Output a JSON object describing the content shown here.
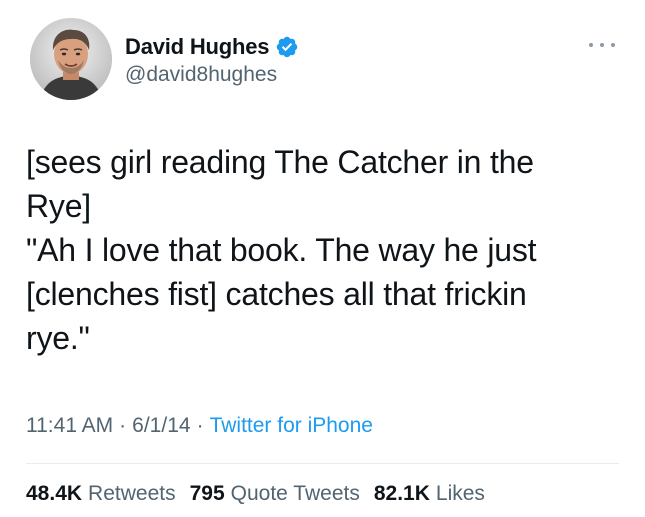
{
  "author": {
    "name": "David Hughes",
    "handle": "@david8hughes",
    "verified": true,
    "verified_color": "#1d9bf0"
  },
  "tweet": {
    "text": "[sees girl reading The Catcher in the\nRye]\n\"Ah I love that book. The way he just\n[clenches fist] catches all that frickin\nrye.\""
  },
  "meta": {
    "time": "11:41 AM",
    "separator": "·",
    "date": "6/1/14",
    "source": "Twitter for iPhone"
  },
  "stats": {
    "retweets_count": "48.4K",
    "retweets_label": "Retweets",
    "quotes_count": "795",
    "quotes_label": "Quote Tweets",
    "likes_count": "82.1K",
    "likes_label": "Likes"
  },
  "icons": {
    "avatar": "avatar-photo",
    "verified": "verified-badge-icon",
    "more": "more-options-icon"
  },
  "colors": {
    "text": "#0f1419",
    "secondary": "#536471",
    "link": "#1d9bf0",
    "divider": "#e6ecf0"
  }
}
